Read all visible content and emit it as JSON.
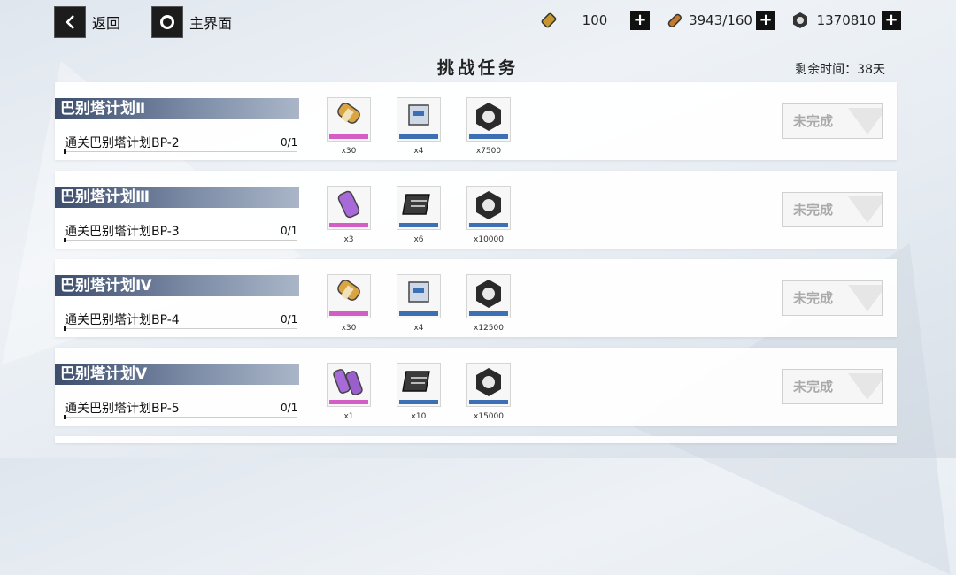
{
  "nav": {
    "back_label": "返回",
    "home_label": "主界面"
  },
  "resources": [
    {
      "icon": "battery-icon",
      "value": "100"
    },
    {
      "icon": "energy-cell-icon",
      "value": "3943/160"
    },
    {
      "icon": "nut-icon",
      "value": "1370810"
    }
  ],
  "page_title": "挑战任务",
  "time_left": "剩余时间：38天",
  "tasks": [
    {
      "title": "巴别塔计划Ⅱ",
      "desc": "通关巴别塔计划BP-2",
      "progress": "0/1",
      "progress_fraction": 0,
      "status": "未完成",
      "rewards": [
        {
          "icon": "gold-capsule-icon",
          "rarity": "pink",
          "qty": "x30"
        },
        {
          "icon": "supply-box-icon",
          "rarity": "blue",
          "qty": "x4"
        },
        {
          "icon": "nut-icon",
          "rarity": "blue",
          "qty": "x7500"
        }
      ]
    },
    {
      "title": "巴别塔计划Ⅲ",
      "desc": "通关巴别塔计划BP-3",
      "progress": "0/1",
      "progress_fraction": 0,
      "status": "未完成",
      "rewards": [
        {
          "icon": "purple-capsule-icon",
          "rarity": "pink",
          "qty": "x3"
        },
        {
          "icon": "chip-board-icon",
          "rarity": "blue",
          "qty": "x6"
        },
        {
          "icon": "nut-icon",
          "rarity": "blue",
          "qty": "x10000"
        }
      ]
    },
    {
      "title": "巴别塔计划Ⅳ",
      "desc": "通关巴别塔计划BP-4",
      "progress": "0/1",
      "progress_fraction": 0,
      "status": "未完成",
      "rewards": [
        {
          "icon": "gold-capsule-icon",
          "rarity": "pink",
          "qty": "x30"
        },
        {
          "icon": "supply-box-icon",
          "rarity": "blue",
          "qty": "x4"
        },
        {
          "icon": "nut-icon",
          "rarity": "blue",
          "qty": "x12500"
        }
      ]
    },
    {
      "title": "巴别塔计划Ⅴ",
      "desc": "通关巴别塔计划BP-5",
      "progress": "0/1",
      "progress_fraction": 0,
      "status": "未完成",
      "rewards": [
        {
          "icon": "purple-double-capsule-icon",
          "rarity": "pink",
          "qty": "x1"
        },
        {
          "icon": "chip-board-icon",
          "rarity": "blue",
          "qty": "x10"
        },
        {
          "icon": "nut-icon",
          "rarity": "blue",
          "qty": "x15000"
        }
      ]
    }
  ],
  "colors": {
    "rarity_pink": "#d35fc4",
    "rarity_blue": "#3d6fb5",
    "accent_dark": "#1c1c1c"
  }
}
